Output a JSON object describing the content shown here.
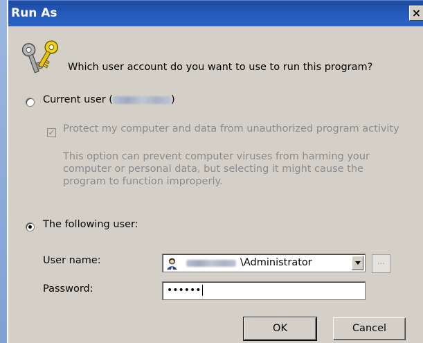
{
  "window": {
    "title": "Run As",
    "close_glyph": "×"
  },
  "dialog": {
    "question": "Which user account do you want to use to run this program?",
    "current_user": {
      "label_prefix": "Current user (",
      "label_suffix": ")",
      "selected": false
    },
    "protect_checkbox": {
      "label": "Protect my computer and data from unauthorized program activity",
      "checked": true,
      "enabled": false
    },
    "protect_description": "This option can prevent computer viruses from harming your computer or personal data, but selecting it might cause the program to function improperly.",
    "following_user": {
      "label": "The following user:",
      "selected": true
    },
    "username": {
      "label": "User name:",
      "value_suffix": "\\Administrator",
      "browse_label": "..."
    },
    "password": {
      "label": "Password:",
      "masked_value": "••••••"
    },
    "buttons": {
      "ok": "OK",
      "cancel": "Cancel"
    }
  },
  "icons": {
    "keys": "keys-icon",
    "user": "user-icon",
    "dropdown": "chevron-down-icon"
  },
  "colors": {
    "title_bar": "#2458b9",
    "dialog_bg": "#d4d0c8",
    "disabled_text": "#8a8a8a"
  }
}
